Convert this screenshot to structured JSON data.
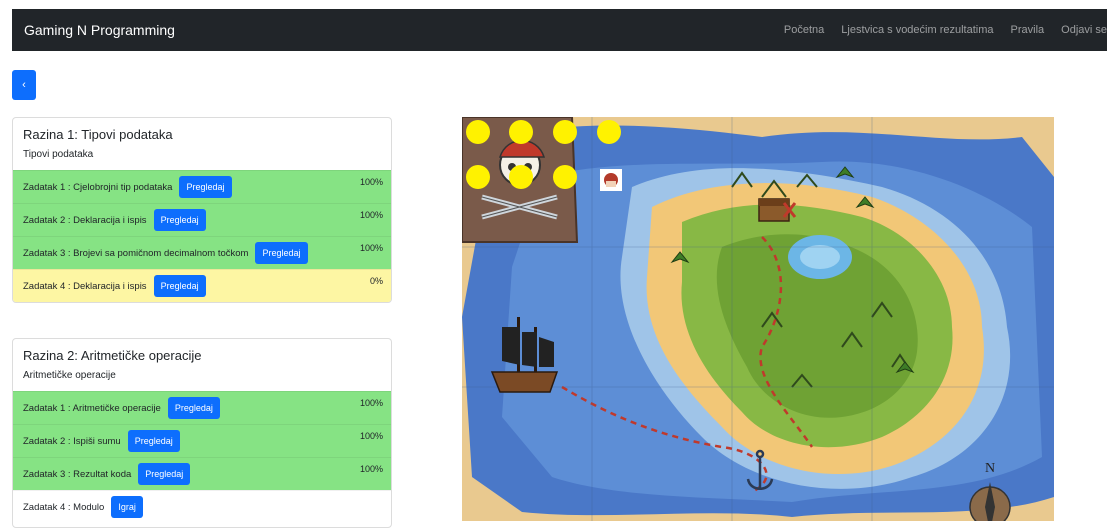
{
  "navbar": {
    "brand": "Gaming N Programming",
    "links": [
      "Početna",
      "Ljestvica s vodećim rezultatima",
      "Pravila",
      "Odjavi se"
    ]
  },
  "back_button": {
    "label": "‹"
  },
  "levels": [
    {
      "title": "Razina 1: Tipovi podataka",
      "subtitle": "Tipovi podataka",
      "tasks": [
        {
          "label": "Zadatak 1 : Cjelobrojni tip podataka",
          "button": "Pregledaj",
          "percent": "100%"
        },
        {
          "label": "Zadatak 2 : Deklaracija i ispis",
          "button": "Pregledaj",
          "percent": "100%"
        },
        {
          "label": "Zadatak 3 : Brojevi sa pomičnom decimalnom točkom",
          "button": "Pregledaj",
          "percent": "100%"
        },
        {
          "label": "Zadatak 4 : Deklaracija i ispis",
          "button": "Pregledaj",
          "percent": "0%"
        }
      ]
    },
    {
      "title": "Razina 2: Aritmetičke operacije",
      "subtitle": "Aritmetičke operacije",
      "tasks": [
        {
          "label": "Zadatak 1 : Aritmetičke operacije",
          "button": "Pregledaj",
          "percent": "100%"
        },
        {
          "label": "Zadatak 2 : Ispiši sumu",
          "button": "Pregledaj",
          "percent": "100%"
        },
        {
          "label": "Zadatak 3 : Rezultat koda",
          "button": "Pregledaj",
          "percent": "100%"
        },
        {
          "label": "Zadatak 4 : Modulo",
          "button": "Igraj",
          "percent": ""
        }
      ]
    }
  ],
  "colors": {
    "navbar_bg": "#212529",
    "primary": "#0d6efd",
    "done_row": "#86e384",
    "zero_row": "#fdf6a3",
    "marker": "#fff200"
  },
  "map": {
    "icons": [
      "treasure-map-illustration",
      "pirate-flag-icon",
      "pirate-ship-icon",
      "treasure-chest-icon",
      "anchor-icon",
      "compass-icon",
      "player-avatar-icon"
    ],
    "level_markers_count": 7
  }
}
